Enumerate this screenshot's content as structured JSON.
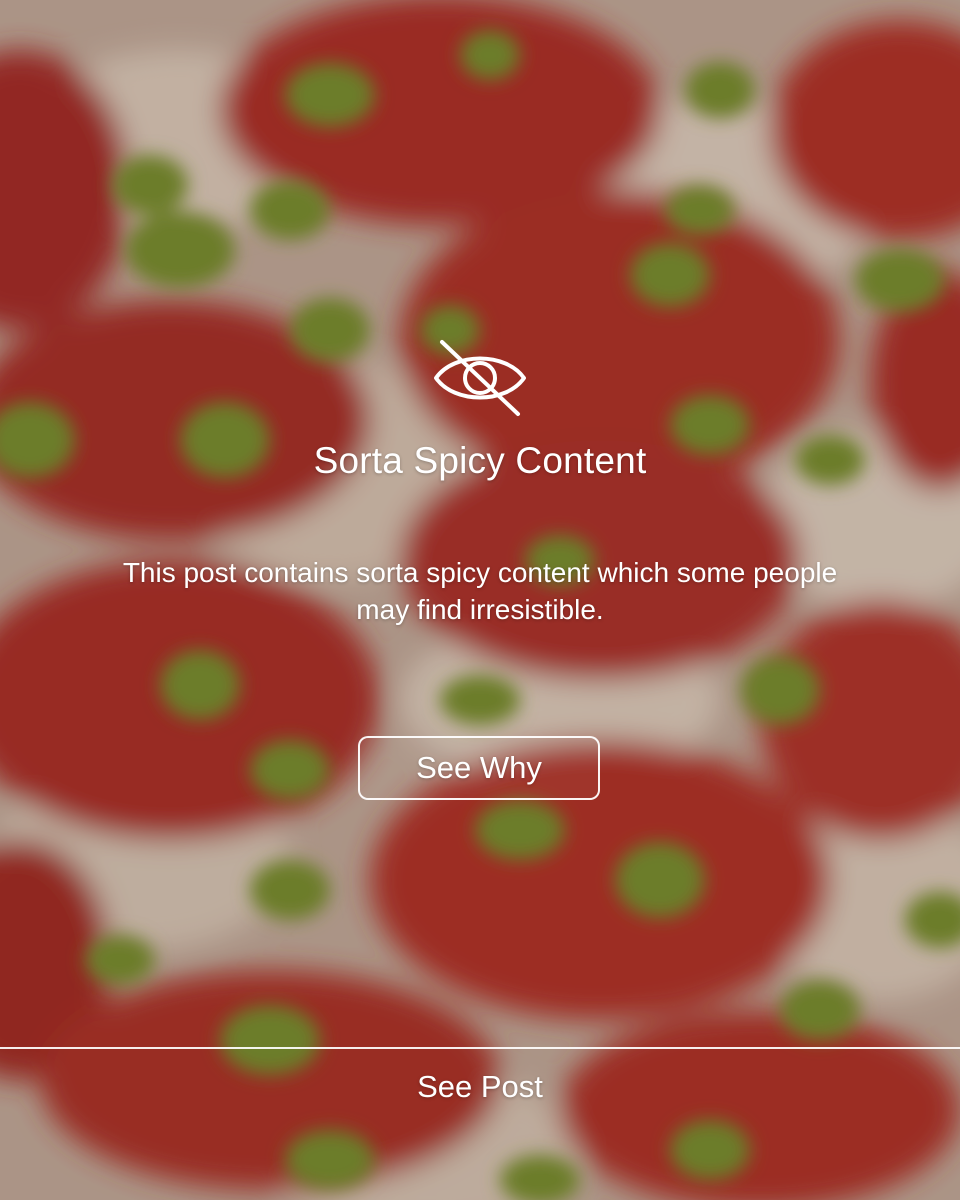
{
  "warning": {
    "title": "Sorta Spicy Content",
    "description": "This post contains sorta spicy content which some people may find irresistible.",
    "icon": "eye-slash-icon"
  },
  "actions": {
    "see_why_label": "See Why",
    "see_post_label": "See Post"
  },
  "colors": {
    "text": "#ffffff",
    "pepperoni": "#b8322a",
    "cheese": "#e8dccd",
    "pepper": "#7a9430"
  }
}
